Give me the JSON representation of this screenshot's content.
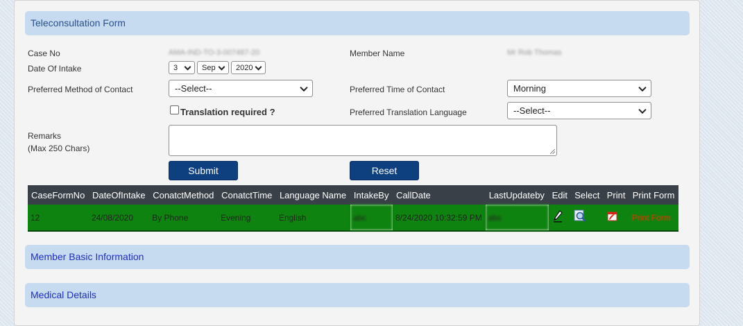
{
  "form": {
    "title": "Teleconsultation Form",
    "case_no_label": "Case No",
    "case_no_value": "AMA-IND-TO-3-007487-20",
    "member_name_label": "Member Name",
    "member_name_value": "Mr Rob Thomas",
    "date_of_intake_label": "Date Of Intake",
    "date_day": "3",
    "date_month": "Sep",
    "date_year": "2020",
    "preferred_method_label": "Preferred Method of Contact",
    "preferred_method_value": "--Select--",
    "preferred_time_label": "Preferred Time of Contact",
    "preferred_time_value": "Morning",
    "translation_label": "Translation required ?",
    "translation_checked": false,
    "preferred_language_label": "Preferred Translation Language",
    "preferred_language_value": "--Select--",
    "remarks_label": "Remarks",
    "remarks_sublabel": "(Max 250 Chars)",
    "remarks_value": "",
    "submit_label": "Submit",
    "reset_label": "Reset"
  },
  "grid": {
    "headers": [
      "CaseFormNo",
      "DateOfIntake",
      "ConatctMethod",
      "ConatctTime",
      "Language Name",
      "IntakeBy",
      "CallDate",
      "LastUpdateby",
      "Edit",
      "Select",
      "Print",
      "Print Form"
    ],
    "rows": [
      {
        "case_form_no": "12",
        "date_of_intake": "24/08/2020",
        "contact_method": "By Phone",
        "contact_time": "Evening",
        "language_name": "English",
        "intake_by": "abc",
        "call_date": "8/24/2020 10:32:59 PM",
        "last_update_by": "abc",
        "edit_icon": "pencil-icon",
        "select_icon": "magnifier-icon",
        "print_icon": "pdf-icon",
        "print_form_link": "Print Form"
      }
    ]
  },
  "sections": {
    "member_basic_info": "Member Basic Information",
    "medical_details": "Medical Details"
  },
  "colors": {
    "header_bg": "#c6dbef",
    "button_bg": "#0e3f7f",
    "grid_header_bg": "#3a4048",
    "grid_row_bg": "#0f830f",
    "print_link": "#ff2a00"
  }
}
